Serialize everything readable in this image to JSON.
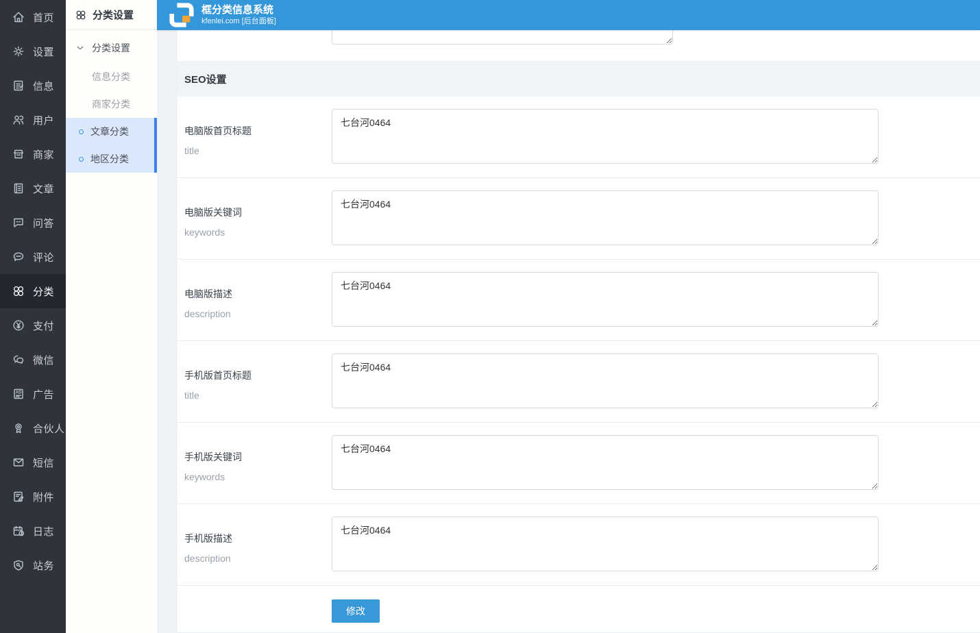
{
  "header": {
    "title": "框分类信息系统",
    "subtitle": "kfenlei.com [后台面板]",
    "logo_icon": "logo-mark",
    "bg_color": "#3397da"
  },
  "sidebar": {
    "bg_color": "#2f343c",
    "items": [
      {
        "id": "home",
        "label": "首页",
        "icon": "home-icon",
        "active": false
      },
      {
        "id": "settings",
        "label": "设置",
        "icon": "gear-icon",
        "active": false
      },
      {
        "id": "info",
        "label": "信息",
        "icon": "info-doc-icon",
        "active": false
      },
      {
        "id": "users",
        "label": "用户",
        "icon": "users-icon",
        "active": false
      },
      {
        "id": "merchants",
        "label": "商家",
        "icon": "store-icon",
        "active": false
      },
      {
        "id": "articles",
        "label": "文章",
        "icon": "article-icon",
        "active": false
      },
      {
        "id": "qa",
        "label": "问答",
        "icon": "chat-square-icon",
        "active": false
      },
      {
        "id": "comments",
        "label": "评论",
        "icon": "comment-icon",
        "active": false
      },
      {
        "id": "categories",
        "label": "分类",
        "icon": "categories-icon",
        "active": true
      },
      {
        "id": "payment",
        "label": "支付",
        "icon": "yuan-circle-icon",
        "active": false
      },
      {
        "id": "wechat",
        "label": "微信",
        "icon": "wechat-icon",
        "active": false
      },
      {
        "id": "ads",
        "label": "广告",
        "icon": "ad-doc-icon",
        "active": false
      },
      {
        "id": "partners",
        "label": "合伙人",
        "icon": "medal-icon",
        "active": false
      },
      {
        "id": "sms",
        "label": "短信",
        "icon": "envelope-icon",
        "active": false
      },
      {
        "id": "attachments",
        "label": "附件",
        "icon": "file-pen-icon",
        "active": false
      },
      {
        "id": "logs",
        "label": "日志",
        "icon": "calendar-clock-icon",
        "active": false
      },
      {
        "id": "site",
        "label": "站务",
        "icon": "shield-wrench-icon",
        "active": false
      }
    ]
  },
  "subnav": {
    "title": "分类设置",
    "title_icon": "categories-icon",
    "group_label": "分类设置",
    "group_icon": "chevron-down-icon",
    "active_bg": "#dbe8fb",
    "active_bar_color": "#3b7ff0",
    "items": [
      {
        "id": "info-categories",
        "label": "信息分类",
        "active": false
      },
      {
        "id": "merchant-categories",
        "label": "商家分类",
        "active": false
      },
      {
        "id": "article-categories",
        "label": "文章分类",
        "active": true
      },
      {
        "id": "region-categories",
        "label": "地区分类",
        "active": true
      }
    ]
  },
  "main": {
    "section_title": "SEO设置",
    "top_partial_textarea_value": "",
    "form": {
      "rows": [
        {
          "id": "pc-title",
          "label": "电脑版首页标题",
          "sublabel": "title",
          "value": "七台河0464"
        },
        {
          "id": "pc-keywords",
          "label": "电脑版关键词",
          "sublabel": "keywords",
          "value": "七台河0464"
        },
        {
          "id": "pc-description",
          "label": "电脑版描述",
          "sublabel": "description",
          "value": "七台河0464"
        },
        {
          "id": "mobile-title",
          "label": "手机版首页标题",
          "sublabel": "title",
          "value": "七台河0464"
        },
        {
          "id": "mobile-keywords",
          "label": "手机版关键词",
          "sublabel": "keywords",
          "value": "七台河0464"
        },
        {
          "id": "mobile-description",
          "label": "手机版描述",
          "sublabel": "description",
          "value": "七台河0464"
        }
      ],
      "submit_label": "修改",
      "submit_color": "#3898d8"
    }
  }
}
